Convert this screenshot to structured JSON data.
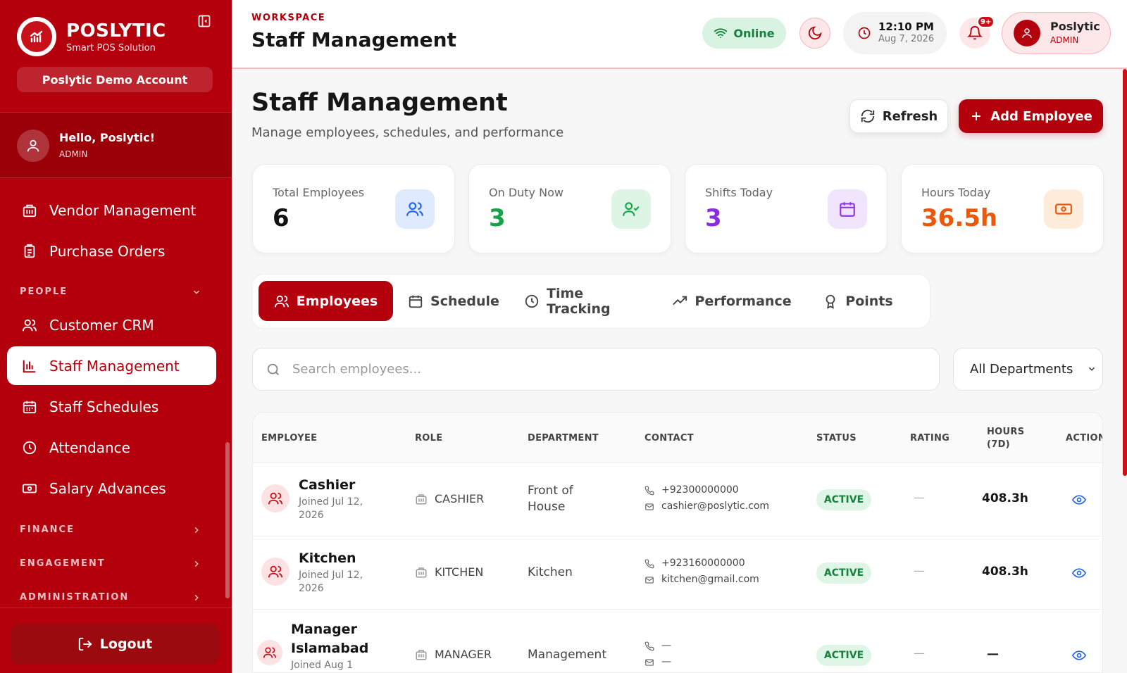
{
  "brand": {
    "name": "POSLYTIC",
    "tagline": "Smart POS Solution",
    "account": "Poslytic Demo Account"
  },
  "user": {
    "greeting": "Hello, Poslytic!",
    "role": "ADMIN"
  },
  "sidebar": {
    "items_top": [
      {
        "label": "Vendor Management",
        "icon": "building-icon"
      },
      {
        "label": "Purchase Orders",
        "icon": "clipboard-icon"
      }
    ],
    "section_people": "PEOPLE",
    "people_items": [
      {
        "label": "Customer CRM",
        "icon": "users-icon"
      },
      {
        "label": "Staff Management",
        "icon": "bar-chart-icon",
        "active": true
      },
      {
        "label": "Staff Schedules",
        "icon": "calendar-icon"
      },
      {
        "label": "Attendance",
        "icon": "clock-icon"
      },
      {
        "label": "Salary Advances",
        "icon": "banknote-icon"
      }
    ],
    "sections": [
      "FINANCE",
      "ENGAGEMENT",
      "ADMINISTRATION"
    ],
    "logout": "Logout"
  },
  "header": {
    "crumb": "WORKSPACE",
    "title": "Staff Management",
    "online": "Online",
    "time": "12:10 PM",
    "date": "Aug 7, 2026",
    "notif_badge": "9+",
    "profile_name": "Poslytic",
    "profile_role": "ADMIN"
  },
  "page": {
    "title": "Staff Management",
    "subtitle": "Manage employees, schedules, and performance",
    "refresh": "Refresh",
    "add": "Add Employee"
  },
  "stats": [
    {
      "label": "Total Employees",
      "value": "6",
      "color": "#111111",
      "icon": "users-icon"
    },
    {
      "label": "On Duty Now",
      "value": "3",
      "color": "#17a34a",
      "icon": "user-check-icon"
    },
    {
      "label": "Shifts Today",
      "value": "3",
      "color": "#8b2be2",
      "icon": "calendar-icon"
    },
    {
      "label": "Hours Today",
      "value": "36.5h",
      "color": "#ea580c",
      "icon": "banknote-icon"
    }
  ],
  "tabs": [
    "Employees",
    "Schedule",
    "Time Tracking",
    "Performance",
    "Points"
  ],
  "search": {
    "placeholder": "Search employees..."
  },
  "dept_filter": "All Departments",
  "table": {
    "headers": [
      "EMPLOYEE",
      "ROLE",
      "DEPARTMENT",
      "CONTACT",
      "STATUS",
      "RATING",
      "HOURS",
      "(7D)",
      "ACTION"
    ],
    "rows": [
      {
        "name": "Cashier",
        "joined": "Joined Jul 12, 2026",
        "role": "CASHIER",
        "department": "Front of House",
        "phone": "+92300000000",
        "email": "cashier@poslytic.com",
        "status": "ACTIVE",
        "rating": "—",
        "hours": "408.3h"
      },
      {
        "name": "Kitchen",
        "joined": "Joined Jul 12, 2026",
        "role": "KITCHEN",
        "department": "Kitchen",
        "phone": "+923160000000",
        "email": "kitchen@gmail.com",
        "status": "ACTIVE",
        "rating": "—",
        "hours": "408.3h"
      },
      {
        "name": "Manager Islamabad",
        "joined": "Joined Aug 1",
        "role": "MANAGER",
        "department": "Management",
        "phone": "—",
        "email": "—",
        "status": "ACTIVE",
        "rating": "—",
        "hours": "—"
      }
    ]
  }
}
